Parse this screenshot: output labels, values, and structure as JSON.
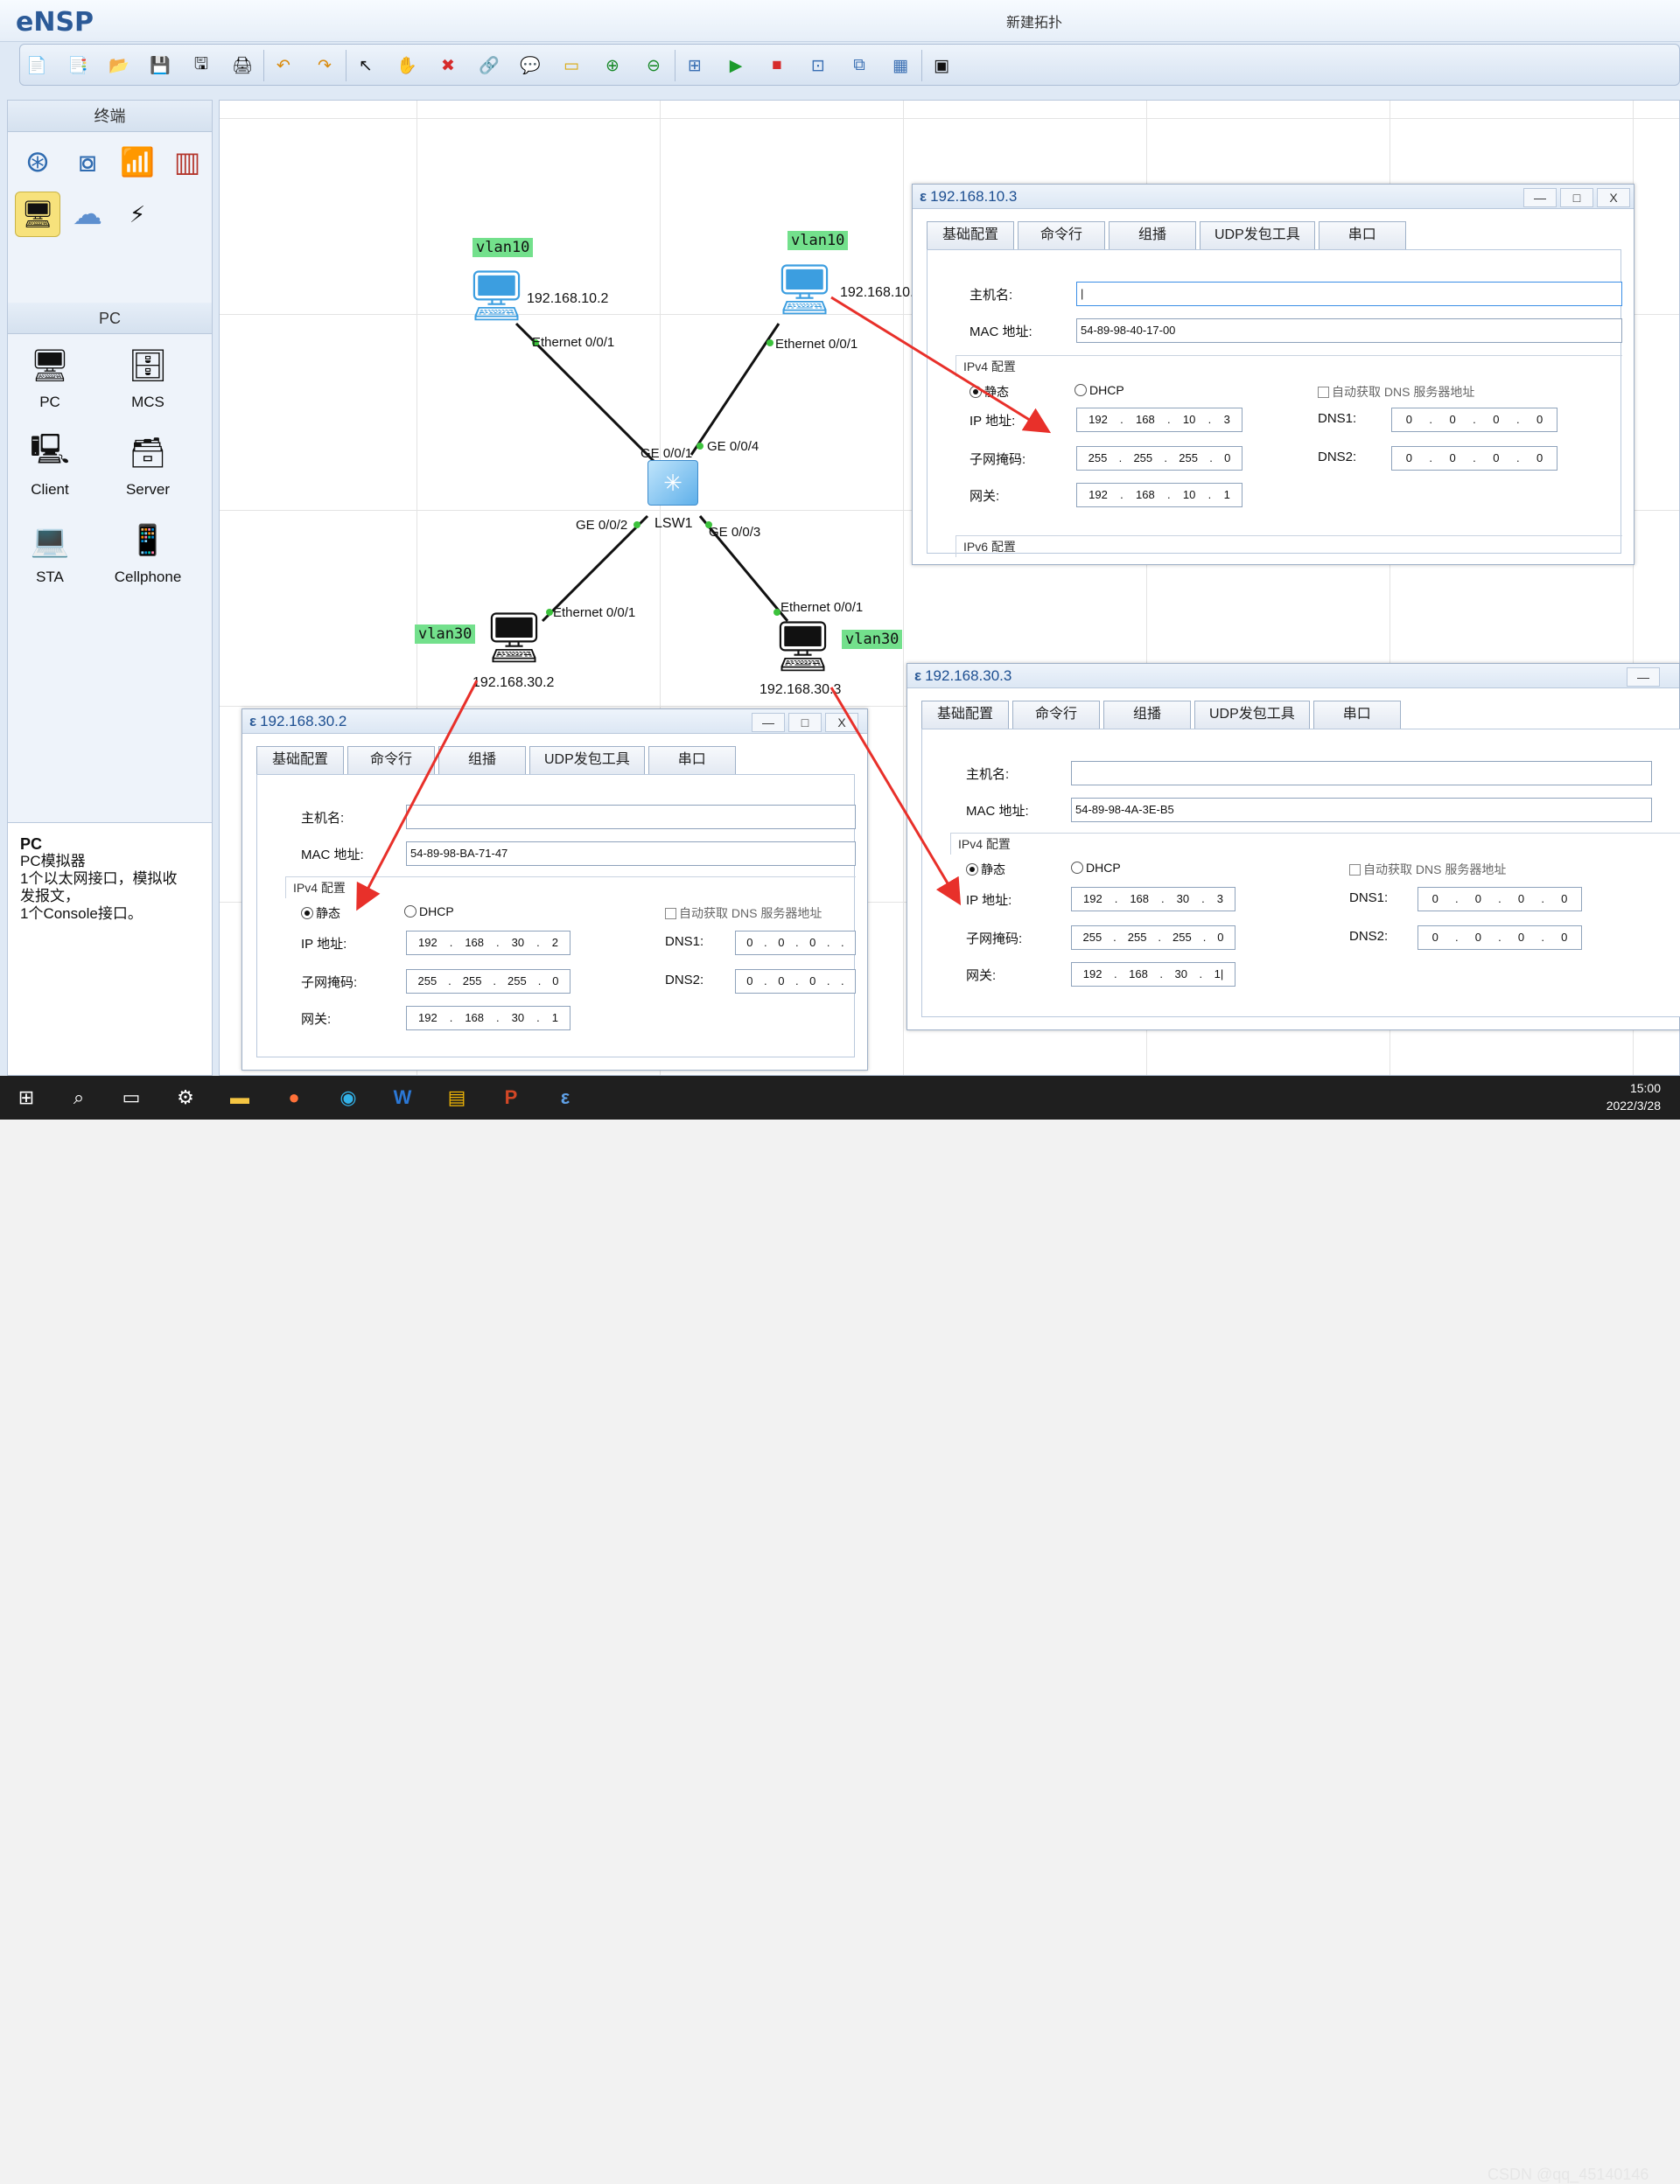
{
  "app": {
    "logo": "eNSP",
    "window_title": "新建拓扑"
  },
  "left_panel": {
    "terminal_header": "终端",
    "pc_header": "PC",
    "pc_devices": [
      "PC",
      "MCS",
      "Client",
      "Server",
      "STA",
      "Cellphone"
    ],
    "desc_title": "PC",
    "desc_lines": [
      "PC模拟器",
      "1个以太网接口，模拟收",
      "发报文，",
      "1个Console接口。"
    ]
  },
  "topology": {
    "vlan_tags": [
      "vlan10",
      "vlan10",
      "vlan30",
      "vlan30"
    ],
    "pc_ips": [
      "192.168.10.2",
      "192.168.10.",
      "192.168.30.2",
      "192.168.30.3"
    ],
    "switch_name": "LSW1",
    "ports": {
      "eth1": "Ethernet 0/0/1",
      "eth2": "Ethernet 0/0/1",
      "eth3": "Ethernet 0/0/1",
      "eth4": "Ethernet 0/0/1",
      "ge1": "GE 0/0/1",
      "ge4": "GE 0/0/4",
      "ge2": "GE 0/0/2",
      "ge3": "GE 0/0/3"
    }
  },
  "dialog_common": {
    "tabs": [
      "基础配置",
      "命令行",
      "组播",
      "UDP发包工具",
      "串口"
    ],
    "hostname_label": "主机名:",
    "mac_label": "MAC 地址:",
    "ipv4_section": "IPv4 配置",
    "ipv6_section": "IPv6 配置",
    "static_label": "静态",
    "dhcp_label": "DHCP",
    "auto_dns_label": "自动获取 DNS 服务器地址",
    "ip_label": "IP 地址:",
    "mask_label": "子网掩码:",
    "gateway_label": "网关:",
    "dns1_label": "DNS1:",
    "dns2_label": "DNS2:",
    "min": "—",
    "max": "□",
    "close": "X"
  },
  "dialog_a": {
    "title": "192.168.10.3",
    "hostname": "|",
    "mac": "54-89-98-40-17-00",
    "ip": [
      "192",
      "168",
      "10",
      "3"
    ],
    "mask": [
      "255",
      "255",
      "255",
      "0"
    ],
    "gateway": [
      "192",
      "168",
      "10",
      "1"
    ],
    "dns1": [
      "0",
      "0",
      "0",
      "0"
    ],
    "dns2": [
      "0",
      "0",
      "0",
      "0"
    ]
  },
  "dialog_b": {
    "title": "192.168.30.2",
    "hostname": "",
    "mac": "54-89-98-BA-71-47",
    "ip": [
      "192",
      "168",
      "30",
      "2"
    ],
    "mask": [
      "255",
      "255",
      "255",
      "0"
    ],
    "gateway": [
      "192",
      "168",
      "30",
      "1"
    ],
    "dns1": [
      "0",
      "0",
      "0",
      "."
    ],
    "dns2": [
      "0",
      "0",
      "0",
      "."
    ]
  },
  "dialog_c": {
    "title": "192.168.30.3",
    "hostname": "",
    "mac": "54-89-98-4A-3E-B5",
    "ip": [
      "192",
      "168",
      "30",
      "3"
    ],
    "mask": [
      "255",
      "255",
      "255",
      "0"
    ],
    "gateway": [
      "192",
      "168",
      "30",
      "1|"
    ],
    "dns1": [
      "0",
      "0",
      "0",
      "0"
    ],
    "dns2": [
      "0",
      "0",
      "0",
      "0"
    ]
  },
  "taskbar": {
    "time": "15:00",
    "date": "2022/3/28",
    "watermark": "CSDN @qq_45140146"
  },
  "colors": {
    "arrow": "#e8302a",
    "vlan_tag": "#73e08c",
    "title_text": "#1d4f91"
  }
}
